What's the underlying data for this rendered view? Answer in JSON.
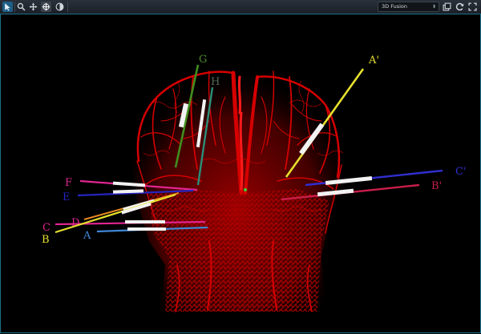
{
  "toolbar": {
    "mode_value": "3D Fusion",
    "mode_arrows": "⬍"
  },
  "electrodes": {
    "A": "A",
    "A_prime": "A'",
    "B": "B",
    "B_prime": "B'",
    "C": "C",
    "C_prime": "C'",
    "D": "D",
    "E": "E",
    "F": "F",
    "G": "G",
    "H": "H"
  },
  "colors": {
    "vessels": "#d00000",
    "electrode_A": "#3f86d6",
    "electrode_A_prime": "#e6e02e",
    "electrode_B": "#e6e02e",
    "electrode_B_prime": "#c81e4a",
    "electrode_C": "#e02590",
    "electrode_C_prime": "#2f2fcf",
    "electrode_D": "#e6881f",
    "electrode_E": "#2525c0",
    "electrode_F": "#e02590",
    "electrode_G": "#3f8f1e",
    "electrode_H": "#2a8f7a",
    "accent": "#1e6f8a"
  },
  "icons": [
    "pointer-icon",
    "zoom-icon",
    "pan-icon",
    "rotate-icon",
    "contrast-icon",
    "snapshot-icon",
    "reset-icon",
    "fullscreen-icon"
  ]
}
